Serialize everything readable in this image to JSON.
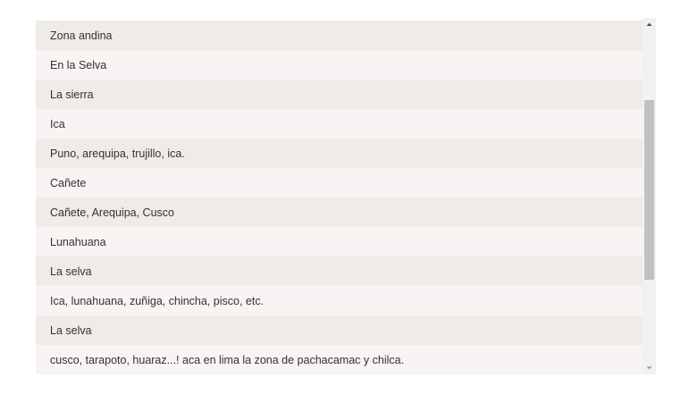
{
  "responses": [
    "Zona andina",
    "En la Selva",
    "La sierra",
    "Ica",
    "Puno, arequipa, trujillo, ica.",
    "Cañete",
    "Cañete, Arequipa, Cusco",
    "Lunahuana",
    "La selva",
    "Ica, lunahuana, zuñiga, chincha, pisco, etc.",
    "La selva",
    "cusco, tarapoto, huaraz...! aca en lima la zona de pachacamac y chilca."
  ],
  "scrollbar": {
    "position_fraction": 0.45,
    "up_icon": "triangle-up-icon",
    "down_icon": "triangle-down-icon"
  },
  "colors": {
    "row_odd": "#efebe6",
    "row_even": "#f7f4f3",
    "text": "#333333",
    "thumb": "#c1c1c1"
  }
}
